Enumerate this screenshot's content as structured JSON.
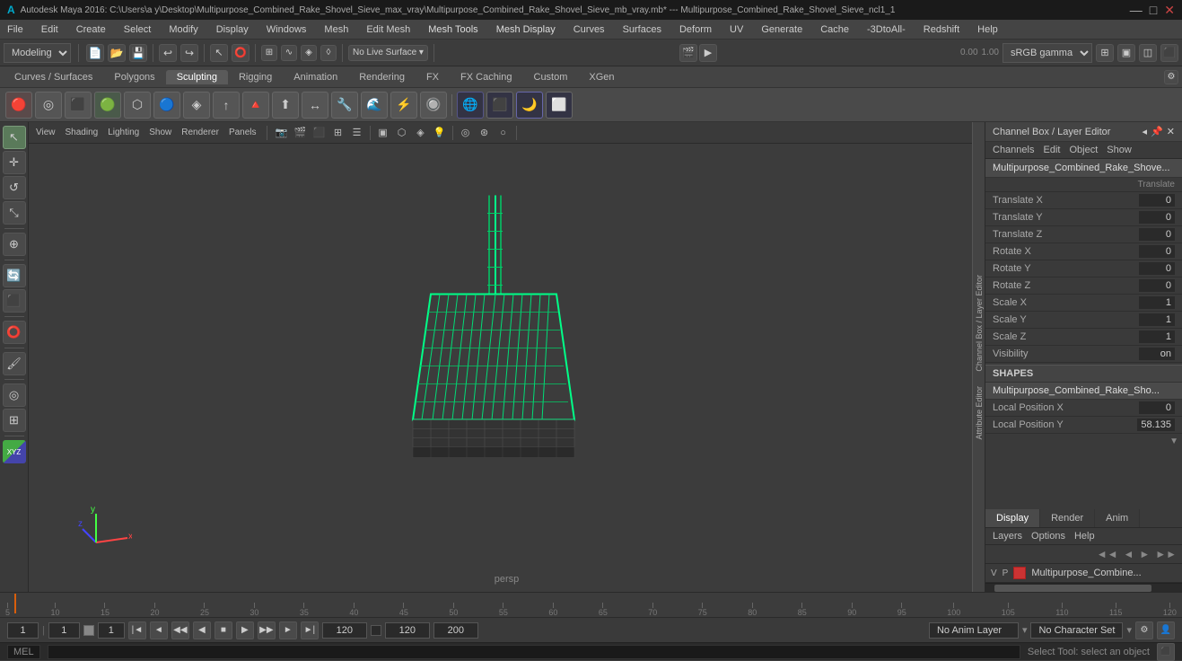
{
  "titlebar": {
    "text": "Autodesk Maya 2016: C:\\Users\\a y\\Desktop\\Multipurpose_Combined_Rake_Shovel_Sieve_max_vray\\Multipurpose_Combined_Rake_Shovel_Sieve_mb_vray.mb* --- Multipurpose_Combined_Rake_Shovel_Sieve_ncl1_1",
    "minimize": "—",
    "maximize": "□",
    "close": "✕"
  },
  "menubar": {
    "items": [
      "File",
      "Edit",
      "Create",
      "Select",
      "Modify",
      "Display",
      "Windows",
      "Mesh",
      "Edit Mesh",
      "Mesh Tools",
      "Mesh Display",
      "Curves",
      "Surfaces",
      "Deform",
      "UV",
      "Generate",
      "Cache",
      "-3DtoAll-",
      "Redshift",
      "Help"
    ]
  },
  "toolbar1": {
    "workspace": "Modeling",
    "gamma": "sRGB gamma",
    "gamma_value": "0.00",
    "gamma_scale": "1.00"
  },
  "shelf": {
    "tabs": [
      "Curves / Surfaces",
      "Polygons",
      "Sculpting",
      "Rigging",
      "Animation",
      "Rendering",
      "FX",
      "FX Caching",
      "Custom",
      "XGen"
    ],
    "active_tab": "Sculpting"
  },
  "viewport": {
    "menu_items": [
      "View",
      "Shading",
      "Lighting",
      "Show",
      "Renderer",
      "Panels"
    ],
    "camera": "persp",
    "label": "persp"
  },
  "channel_box": {
    "title": "Channel Box / Layer Editor",
    "menus": [
      "Channels",
      "Edit",
      "Object",
      "Show"
    ],
    "object_name": "Multipurpose_Combined_Rake_Shove...",
    "channels": [
      {
        "name": "Translate X",
        "value": "0"
      },
      {
        "name": "Translate Y",
        "value": "0"
      },
      {
        "name": "Translate Z",
        "value": "0"
      },
      {
        "name": "Rotate X",
        "value": "0"
      },
      {
        "name": "Rotate Y",
        "value": "0"
      },
      {
        "name": "Rotate Z",
        "value": "0"
      },
      {
        "name": "Scale X",
        "value": "1"
      },
      {
        "name": "Scale Y",
        "value": "1"
      },
      {
        "name": "Scale Z",
        "value": "1"
      },
      {
        "name": "Visibility",
        "value": "on"
      }
    ],
    "shapes_label": "SHAPES",
    "shape_name": "Multipurpose_Combined_Rake_Sho...",
    "shape_channels": [
      {
        "name": "Local Position X",
        "value": "0"
      },
      {
        "name": "Local Position Y",
        "value": "58.135"
      }
    ],
    "display_tabs": [
      "Display",
      "Render",
      "Anim"
    ],
    "active_display_tab": "Display",
    "layers_menus": [
      "Layers",
      "Options",
      "Help"
    ],
    "translate_label": "Translate"
  },
  "layers": {
    "entry": {
      "v": "V",
      "p": "P",
      "name": "Multipurpose_Combine..."
    }
  },
  "timeline": {
    "ticks": [
      "5",
      "10",
      "15",
      "20",
      "25",
      "30",
      "35",
      "40",
      "45",
      "50",
      "55",
      "60",
      "65",
      "70",
      "75",
      "80",
      "85",
      "90",
      "95",
      "100",
      "105",
      "110",
      "115",
      "120"
    ],
    "current_frame": "1",
    "range_start": "1",
    "range_end": "120",
    "range_end2": "120",
    "range_end3": "200",
    "anim_layer": "No Anim Layer",
    "char_set": "No Character Set"
  },
  "status_bar": {
    "mel_label": "MEL",
    "tool_text": "Select Tool: select an object",
    "placeholder": ""
  },
  "icons": {
    "select": "↖",
    "move": "✛",
    "rotate": "↺",
    "scale": "⤡",
    "lasso": "⭕",
    "paint": "🖌",
    "gear": "⚙",
    "eye": "👁",
    "grid": "⊞",
    "camera": "📷",
    "light": "💡",
    "curve": "∿",
    "poly": "⬡"
  },
  "attr_sidebar_labels": [
    "Channel Box / Layer Editor",
    "Attribute Editor"
  ]
}
